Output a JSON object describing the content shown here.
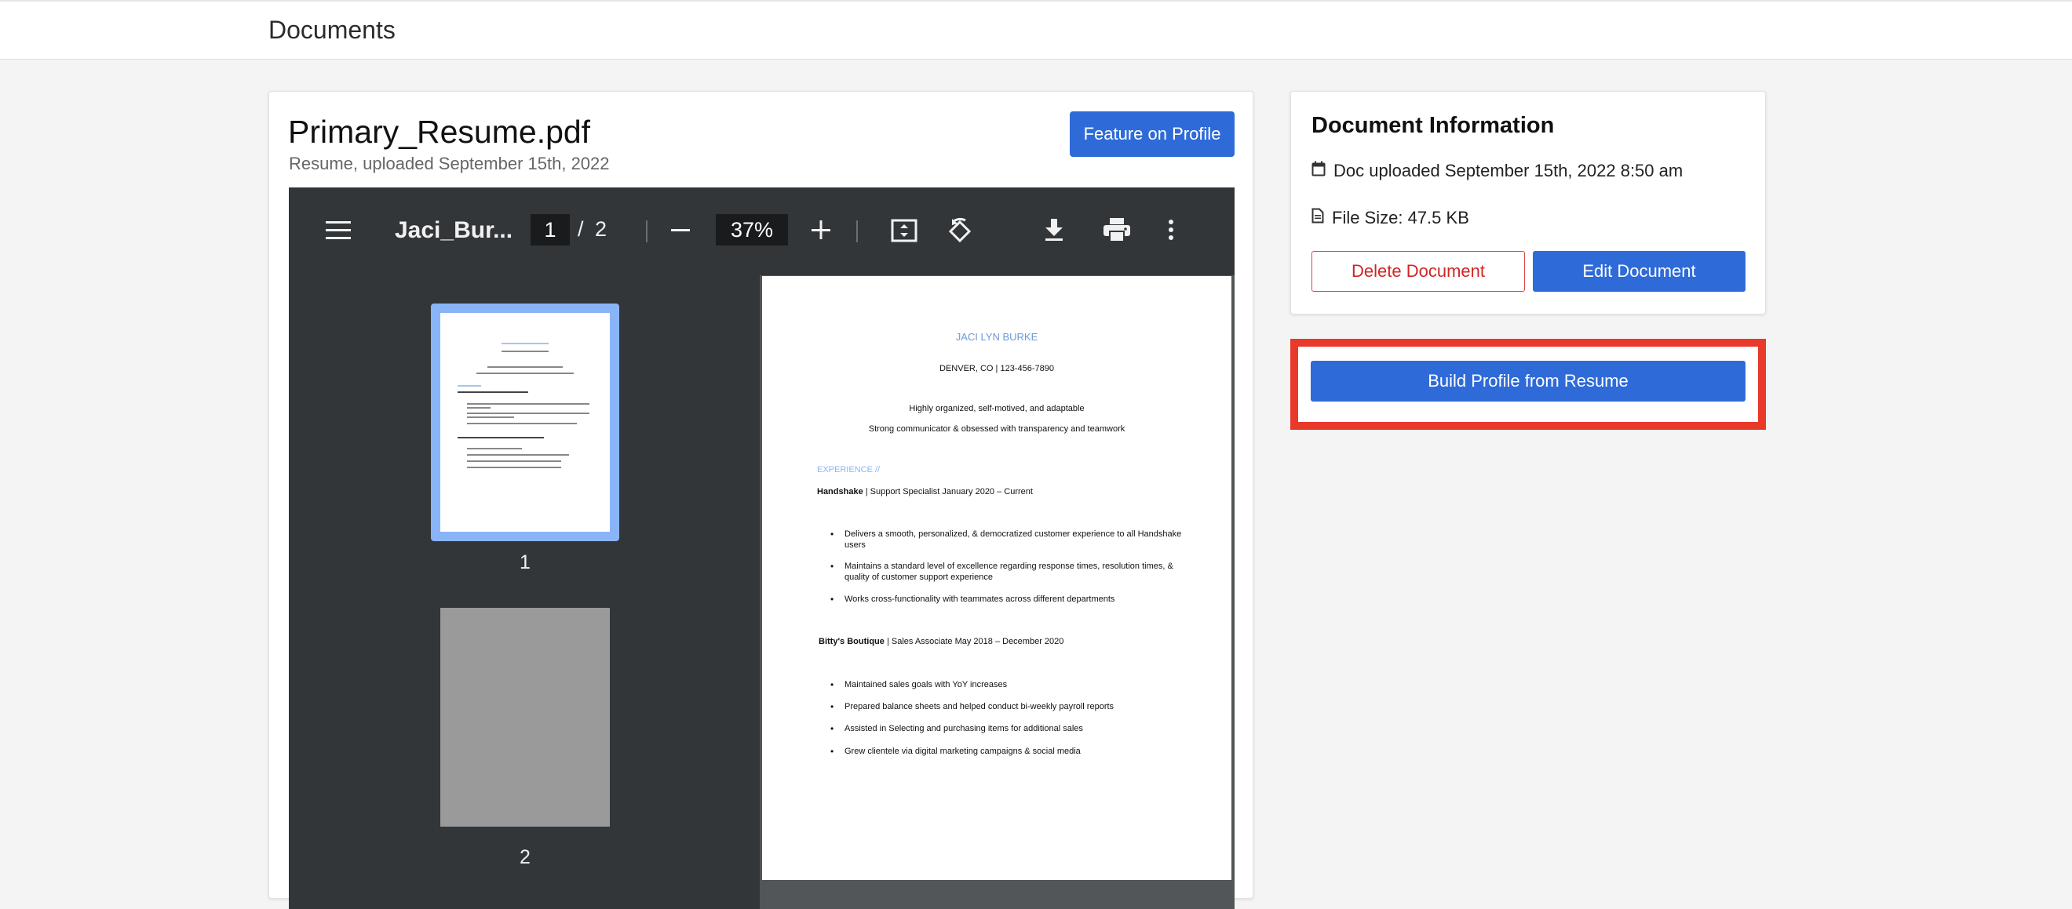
{
  "header": {
    "title": "Documents"
  },
  "document": {
    "file_name": "Primary_Resume.pdf",
    "subtitle": "Resume, uploaded September 15th, 2022",
    "feature_label": "Feature on Profile"
  },
  "viewer": {
    "file_name": "Jaci_Bur...",
    "current_page": "1",
    "separator": "/",
    "total_pages": "2",
    "zoom": "37%",
    "thumbnails": [
      "1",
      "2"
    ]
  },
  "resume": {
    "name": "JACI LYN BURKE",
    "contact": "DENVER, CO | 123-456-7890",
    "summary_1": "Highly organized, self-motived, and adaptable",
    "summary_2": "Strong communicator & obsessed with transparency and teamwork",
    "section": "EXPERIENCE //",
    "job1": {
      "company": "Handshake",
      "detail": " | Support Specialist January  2020 – Current"
    },
    "job1_bullets": [
      "Delivers a smooth, personalized, & democratized customer experience to all Handshake users",
      "Maintains a standard level of excellence regarding response times, resolution times, & quality of customer support experience",
      "Works cross-functionality with teammates across different departments"
    ],
    "job2": {
      "company": "Bitty's Boutique",
      "detail": " | Sales Associate  May  2018 – December 2020"
    },
    "job2_bullets": [
      "Maintained sales goals with YoY increases",
      "Prepared balance sheets and helped conduct bi-weekly payroll reports",
      "Assisted in Selecting and purchasing items for additional sales",
      "Grew clientele via digital marketing campaigns & social media"
    ]
  },
  "info": {
    "title": "Document Information",
    "uploaded": "Doc uploaded September 15th, 2022 8:50 am",
    "file_size": "File Size: 47.5 KB",
    "delete_label": "Delete Document",
    "edit_label": "Edit Document"
  },
  "build": {
    "label": "Build Profile from Resume"
  },
  "colors": {
    "primary": "#2f6bd8",
    "danger": "#d02525",
    "highlight": "#e8392b",
    "viewer_toolbar": "#323639"
  }
}
